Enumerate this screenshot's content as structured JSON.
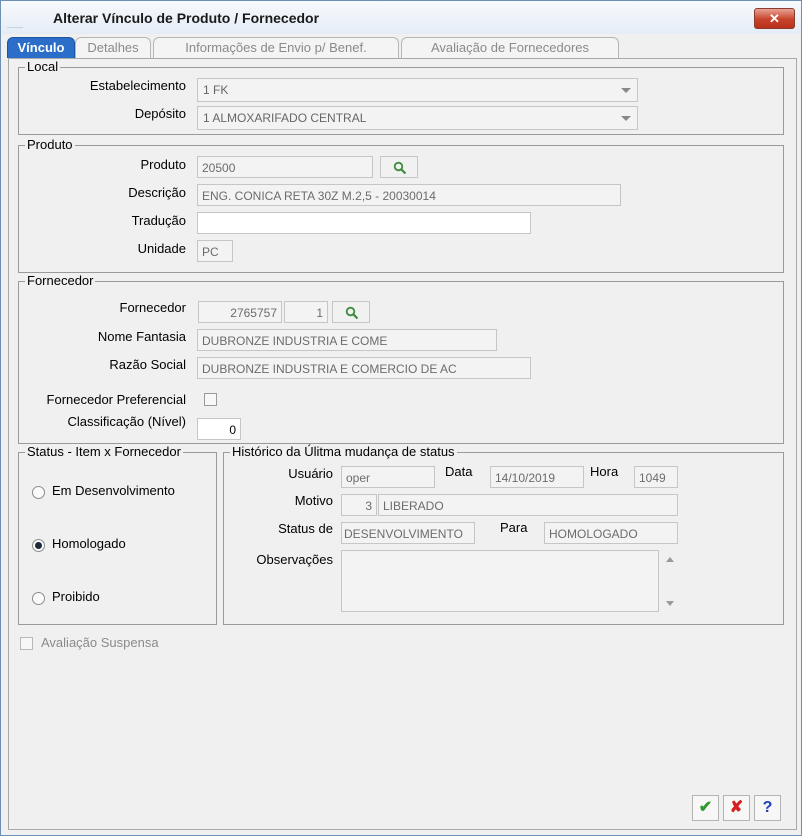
{
  "window": {
    "title": "Alterar Vínculo de Produto / Fornecedor",
    "close_label": "✕"
  },
  "tabs": [
    {
      "label": "Vínculo",
      "active": true
    },
    {
      "label": "Detalhes",
      "active": false
    },
    {
      "label": "Informações de Envio p/ Benef.",
      "active": false
    },
    {
      "label": "Avaliação de Fornecedores",
      "active": false
    }
  ],
  "local": {
    "legend": "Local",
    "estabelecimento_label": "Estabelecimento",
    "estabelecimento_value": "1 FK",
    "deposito_label": "Depósito",
    "deposito_value": "1 ALMOXARIFADO CENTRAL"
  },
  "produto": {
    "legend": "Produto",
    "produto_label": "Produto",
    "produto_value": "20500",
    "descricao_label": "Descrição",
    "descricao_value": "ENG. CONICA RETA 30Z M.2,5 - 20030014",
    "traducao_label": "Tradução",
    "traducao_value": "",
    "unidade_label": "Unidade",
    "unidade_value": "PC"
  },
  "fornecedor": {
    "legend": "Fornecedor",
    "fornecedor_label": "Fornecedor",
    "fornecedor_code": "2765757",
    "fornecedor_seq": "1",
    "nome_fantasia_label": "Nome Fantasia",
    "nome_fantasia_value": "DUBRONZE INDUSTRIA E COME",
    "razao_social_label": "Razão Social",
    "razao_social_value": "DUBRONZE INDUSTRIA E COMERCIO DE AC",
    "preferencial_label": "Fornecedor Preferencial",
    "preferencial_checked": false,
    "classificacao_label": "Classificação (Nível)",
    "classificacao_value": "0"
  },
  "status": {
    "legend": "Status - Item x Fornecedor",
    "options": [
      {
        "label": "Em Desenvolvimento",
        "selected": false
      },
      {
        "label": "Homologado",
        "selected": true
      },
      {
        "label": "Proibido",
        "selected": false
      }
    ]
  },
  "historico": {
    "legend": "Histórico da Úlitma mudança de status",
    "usuario_label": "Usuário",
    "usuario_value": "oper",
    "data_label": "Data",
    "data_value": "14/10/2019",
    "hora_label": "Hora",
    "hora_value": "1049",
    "motivo_label": "Motivo",
    "motivo_code": "3",
    "motivo_value": "LIBERADO",
    "status_de_label": "Status de",
    "status_de_value": "DESENVOLVIMENTO",
    "para_label": "Para",
    "para_value": "HOMOLOGADO",
    "observacoes_label": "Observações",
    "observacoes_value": ""
  },
  "avaliacao_suspensa": {
    "label": "Avaliação Suspensa",
    "checked": false
  },
  "footer": {
    "ok_label": "✔",
    "cancel_label": "✘",
    "help_label": "?"
  },
  "colors": {
    "tab_active": "#2a6ec9",
    "ok_green": "#2e9a2e",
    "cancel_red": "#d42020",
    "help_blue": "#1d3fb8"
  }
}
